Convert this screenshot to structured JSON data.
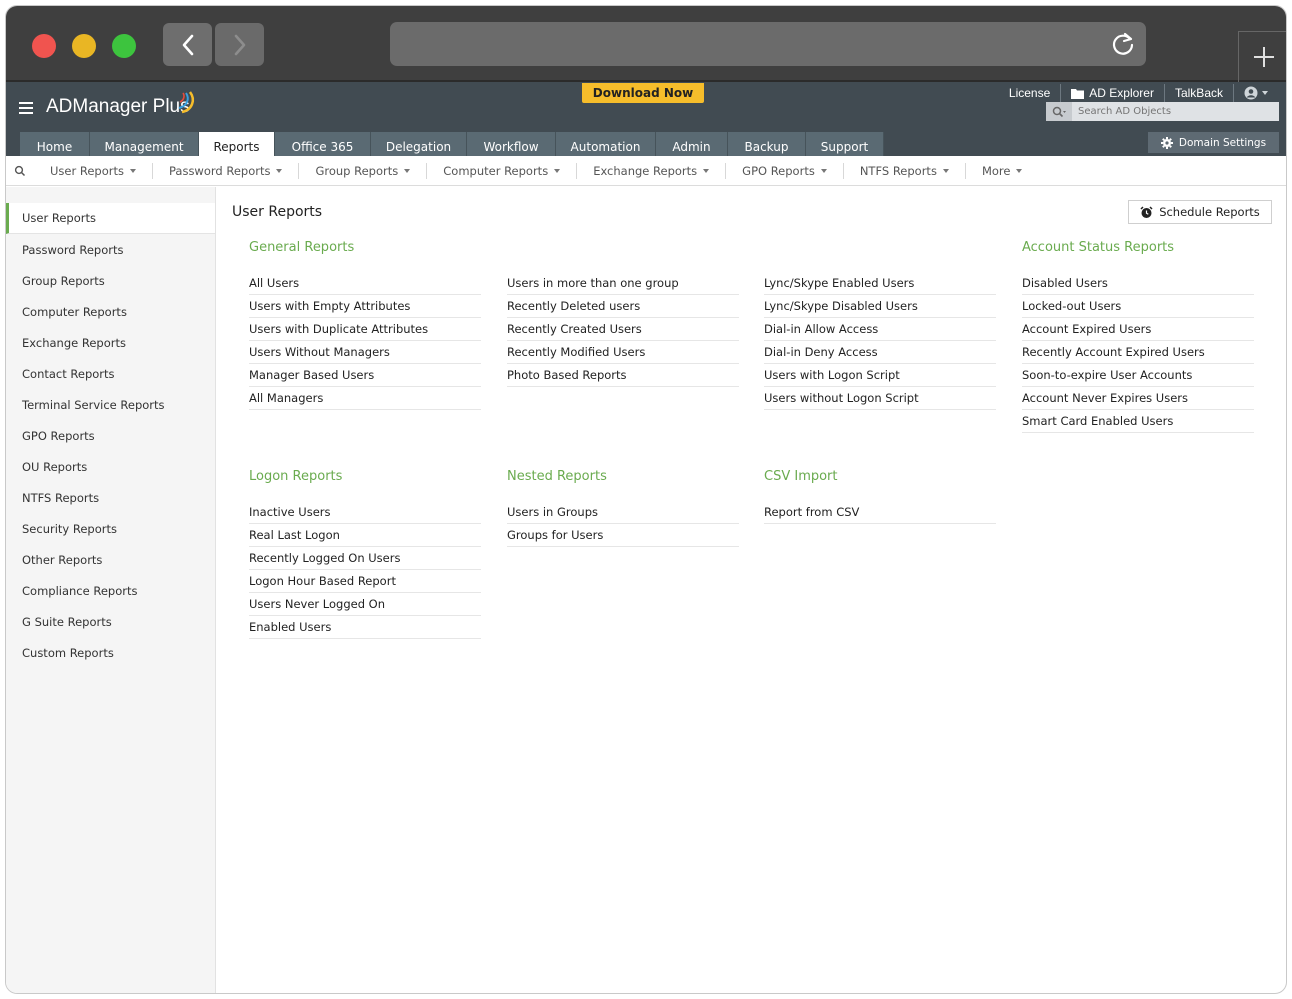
{
  "app": {
    "name": "ADManager Plus",
    "download_label": "Download Now"
  },
  "top_links": {
    "license": "License",
    "ad_explorer": "AD Explorer",
    "talkback": "TalkBack"
  },
  "search": {
    "placeholder": "Search AD Objects"
  },
  "domain_settings": "Domain Settings",
  "tabs": [
    {
      "label": "Home"
    },
    {
      "label": "Management"
    },
    {
      "label": "Reports",
      "active": true
    },
    {
      "label": "Office 365"
    },
    {
      "label": "Delegation"
    },
    {
      "label": "Workflow"
    },
    {
      "label": "Automation"
    },
    {
      "label": "Admin"
    },
    {
      "label": "Backup"
    },
    {
      "label": "Support"
    }
  ],
  "subnav": [
    {
      "label": "User Reports"
    },
    {
      "label": "Password Reports"
    },
    {
      "label": "Group Reports"
    },
    {
      "label": "Computer Reports"
    },
    {
      "label": "Exchange Reports"
    },
    {
      "label": "GPO Reports"
    },
    {
      "label": "NTFS Reports"
    },
    {
      "label": "More"
    }
  ],
  "sidebar": {
    "items": [
      {
        "label": "User Reports",
        "active": true
      },
      {
        "label": "Password Reports"
      },
      {
        "label": "Group Reports"
      },
      {
        "label": "Computer Reports"
      },
      {
        "label": "Exchange Reports"
      },
      {
        "label": "Contact Reports"
      },
      {
        "label": "Terminal Service Reports"
      },
      {
        "label": "GPO Reports"
      },
      {
        "label": "OU Reports"
      },
      {
        "label": "NTFS Reports"
      },
      {
        "label": "Security Reports"
      },
      {
        "label": "Other Reports"
      },
      {
        "label": "Compliance Reports"
      },
      {
        "label": "G Suite Reports"
      },
      {
        "label": "Custom Reports"
      }
    ]
  },
  "main": {
    "title": "User Reports",
    "schedule_label": "Schedule Reports",
    "general": {
      "title": "General Reports",
      "col1": [
        "All Users",
        "Users with Empty Attributes",
        "Users with Duplicate Attributes",
        "Users Without Managers",
        "Manager Based Users",
        "All Managers"
      ],
      "col2": [
        "Users in more than one group",
        "Recently Deleted users",
        "Recently Created Users",
        "Recently Modified Users",
        "Photo Based Reports"
      ],
      "col3": [
        "Lync/Skype Enabled Users",
        "Lync/Skype Disabled Users",
        "Dial-in Allow Access",
        "Dial-in Deny Access",
        "Users with Logon Script",
        "Users without Logon Script"
      ]
    },
    "account_status": {
      "title": "Account Status Reports",
      "items": [
        "Disabled Users",
        "Locked-out Users",
        "Account Expired Users",
        "Recently Account Expired Users",
        "Soon-to-expire User Accounts",
        "Account Never Expires Users",
        "Smart Card Enabled Users"
      ]
    },
    "logon": {
      "title": "Logon Reports",
      "items": [
        "Inactive Users",
        "Real Last Logon",
        "Recently Logged On Users",
        "Logon Hour Based Report",
        "Users Never Logged On",
        "Enabled Users"
      ]
    },
    "nested": {
      "title": "Nested Reports",
      "items": [
        "Users in Groups",
        "Groups for Users"
      ]
    },
    "csv": {
      "title": "CSV Import",
      "items": [
        "Report from CSV"
      ]
    }
  },
  "colors": {
    "accent_green": "#6aab4f",
    "header_bg": "#414b52",
    "tab_bg": "#5a6a73",
    "download_bg": "#f6bd2b"
  }
}
